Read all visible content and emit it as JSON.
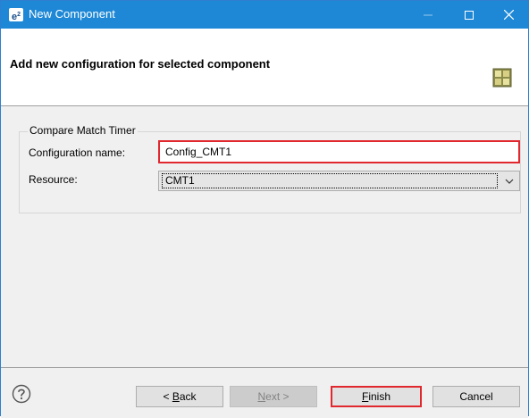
{
  "window": {
    "title": "New Component",
    "app_icon_text": "e",
    "app_icon_sup": "2"
  },
  "banner": {
    "title": "Add new configuration for selected component",
    "icon": "component-grid-icon"
  },
  "group": {
    "legend": "Compare Match Timer",
    "config_label": "Configuration name:",
    "config_value": "Config_CMT1",
    "resource_label": "Resource:",
    "resource_value": "CMT1"
  },
  "footer": {
    "back": {
      "mnemonic": "B",
      "rest": "ack",
      "prefix": "< "
    },
    "next": {
      "mnemonic": "N",
      "rest": "ext",
      "suffix": " >"
    },
    "finish": {
      "mnemonic": "F",
      "rest": "inish"
    },
    "cancel": "Cancel"
  },
  "colors": {
    "titlebar": "#1e88d6",
    "highlight": "#e0282e"
  }
}
